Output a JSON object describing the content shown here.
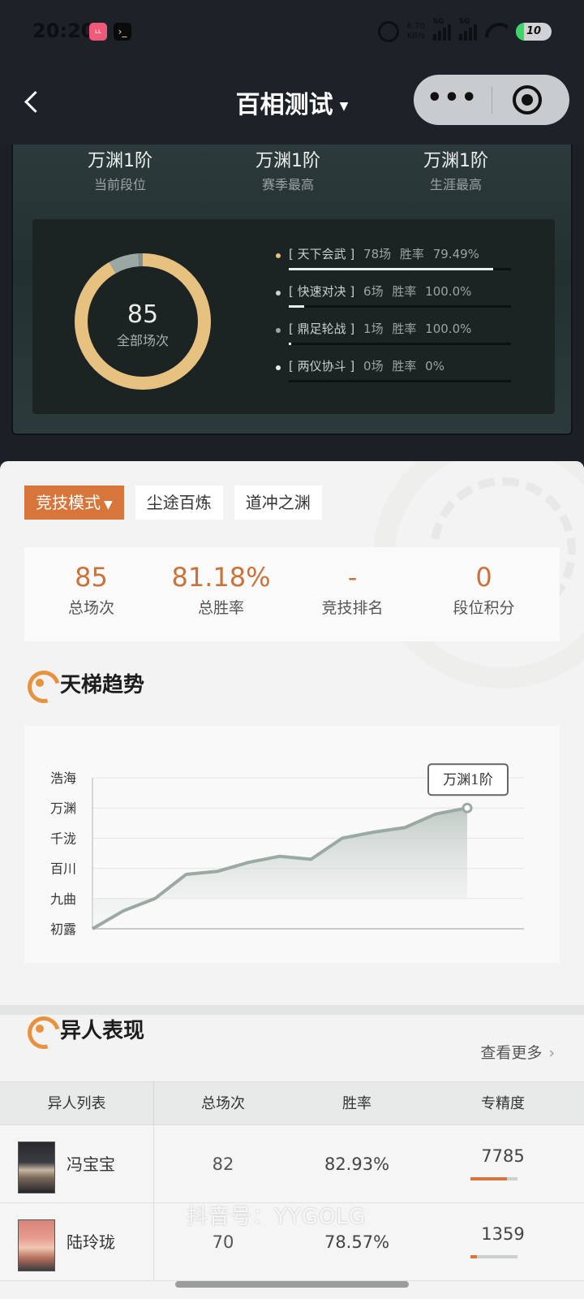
{
  "status_bar": {
    "time": "20:20",
    "net_speed_value": "6.70",
    "net_speed_unit": "KB/s",
    "signal1": "5G",
    "signal2": "5G",
    "battery": "10"
  },
  "nav": {
    "title": "百相测试",
    "more_glyph": "•••"
  },
  "ranks": [
    {
      "value": "万渊1阶",
      "label": "当前段位"
    },
    {
      "value": "万渊1阶",
      "label": "赛季最高"
    },
    {
      "value": "万渊1阶",
      "label": "生涯最高"
    }
  ],
  "summary": {
    "total": "85",
    "total_label": "全部场次",
    "modes": [
      {
        "name": "天下会武",
        "count": "78场",
        "rate_label": "胜率",
        "rate": "79.49%",
        "share": 0.918,
        "color": "#e6c17f"
      },
      {
        "name": "快速对决",
        "count": "6场",
        "rate_label": "胜率",
        "rate": "100.0%",
        "share": 0.071,
        "color": "#9aa7a3"
      },
      {
        "name": "鼎足轮战",
        "count": "1场",
        "rate_label": "胜率",
        "rate": "100.0%",
        "share": 0.012,
        "color": "#7f8f92"
      },
      {
        "name": "两仪协斗",
        "count": "0场",
        "rate_label": "胜率",
        "rate": "0%",
        "share": 0,
        "color": "#d9dcda"
      }
    ]
  },
  "tabs": [
    {
      "label": "竞技模式",
      "caret": "▼"
    },
    {
      "label": "尘途百炼"
    },
    {
      "label": "道冲之渊"
    }
  ],
  "stats": [
    {
      "value": "85",
      "label": "总场次"
    },
    {
      "value": "81.18%",
      "label": "总胜率"
    },
    {
      "value": "-",
      "label": "竞技排名"
    },
    {
      "value": "0",
      "label": "段位积分"
    }
  ],
  "ladder": {
    "title": "天梯趋势",
    "y_levels": [
      "浩海",
      "万渊",
      "千泷",
      "百川",
      "九曲",
      "初露"
    ],
    "callout": "万渊1阶"
  },
  "chart_data": {
    "type": "line",
    "title": "天梯趋势",
    "y_categories": [
      "初露",
      "九曲",
      "百川",
      "千泷",
      "万渊",
      "浩海"
    ],
    "values": [
      0.0,
      0.6,
      1.0,
      1.8,
      1.9,
      2.2,
      2.4,
      2.3,
      3.0,
      3.2,
      3.35,
      3.8,
      4.0
    ],
    "x": [
      0,
      1,
      2,
      3,
      4,
      5,
      6,
      7,
      8,
      9,
      10,
      11,
      12
    ],
    "last_label": "万渊1阶",
    "grid": true
  },
  "performers": {
    "title": "异人表现",
    "more_label": "查看更多",
    "columns": [
      "异人列表",
      "总场次",
      "胜率",
      "专精度"
    ],
    "rows": [
      {
        "name": "冯宝宝",
        "games": "82",
        "rate": "82.93%",
        "mastery": "7785",
        "mastery_level": 0.78
      },
      {
        "name": "陆玲珑",
        "games": "70",
        "rate": "78.57%",
        "mastery": "1359",
        "mastery_level": 0.14
      }
    ]
  },
  "watermark": "抖音号：YYGOLG"
}
